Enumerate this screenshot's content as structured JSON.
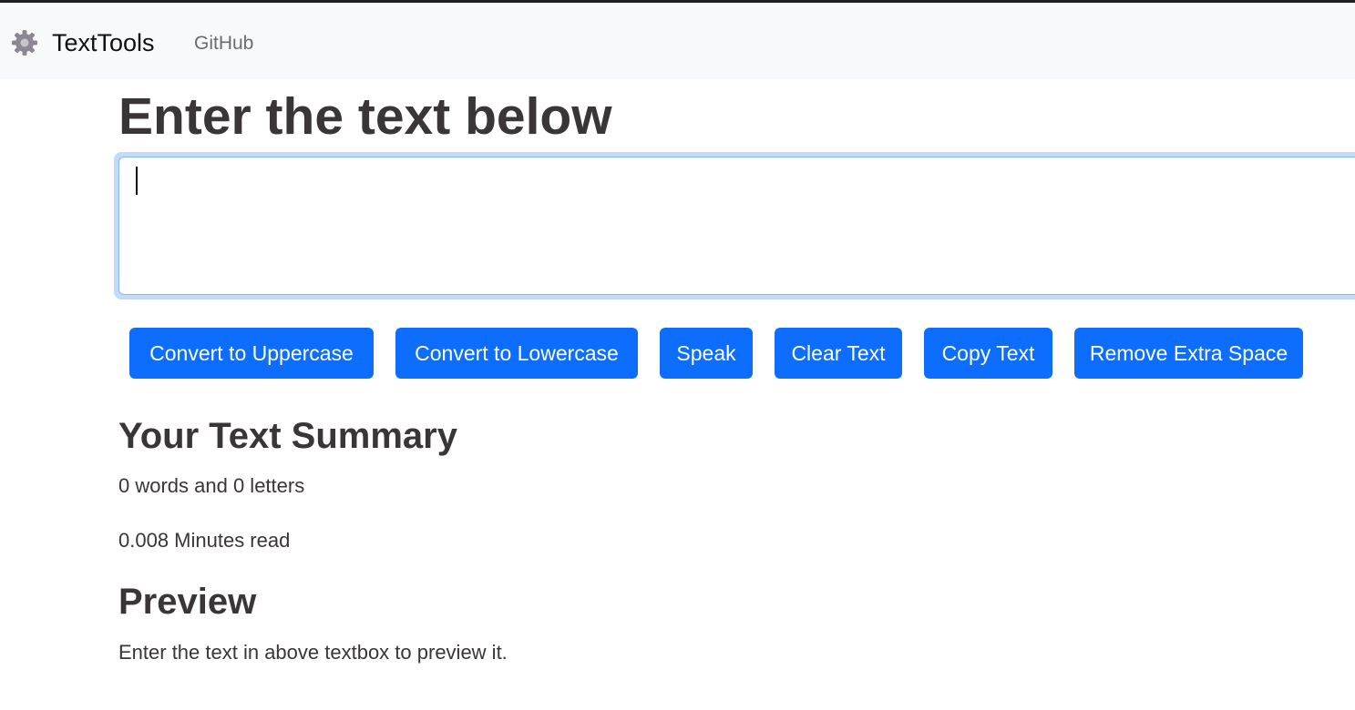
{
  "navbar": {
    "brand_icon": "gear-icon",
    "brand_name": "TextTools",
    "links": [
      "GitHub"
    ]
  },
  "main": {
    "heading": "Enter the text below",
    "textarea_value": ""
  },
  "buttons": [
    "Convert to Uppercase",
    "Convert to Lowercase",
    "Speak",
    "Clear Text",
    "Copy Text",
    "Remove Extra Space"
  ],
  "summary": {
    "heading": "Your Text Summary",
    "counts": "0 words and 0 letters",
    "read_time": "0.008 Minutes read"
  },
  "preview": {
    "heading": "Preview",
    "text": "Enter the text in above textbox to preview it."
  },
  "colors": {
    "primary": "#0d6efd",
    "navbar_bg": "#f8f9fa",
    "text": "#3a3536",
    "focus_ring": "#c4dafb"
  }
}
